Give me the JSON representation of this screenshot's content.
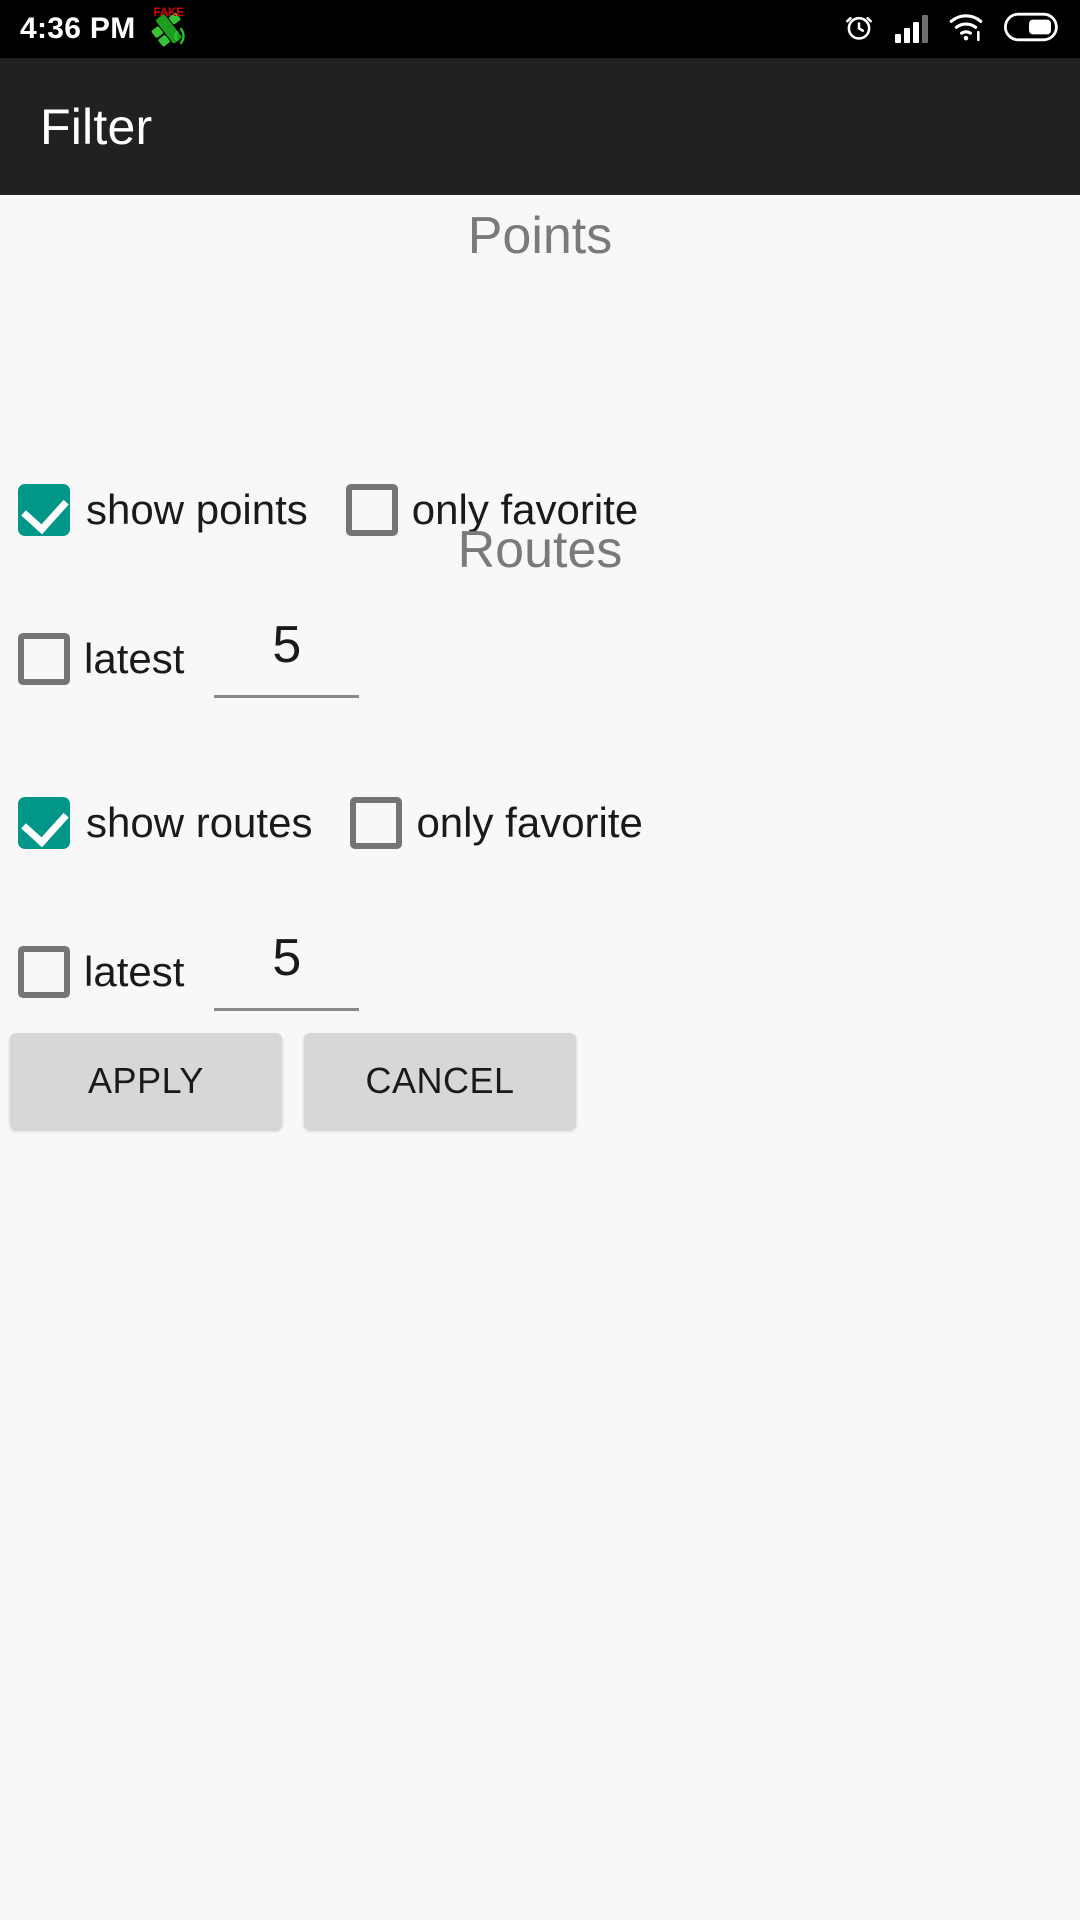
{
  "status_bar": {
    "time": "4:36 PM",
    "fake_gps_label": "FAKE",
    "icons": [
      "fake-gps-icon",
      "alarm-icon",
      "signal-icon",
      "wifi-icon",
      "battery-icon"
    ],
    "background_color": "#000000",
    "text_color": "#FFFFFF"
  },
  "app_bar": {
    "title": "Filter",
    "background_color": "#212121",
    "title_color": "#FFFFFF"
  },
  "theme": {
    "page_background": "#F8F8F8",
    "accent_checked": "#009688",
    "checkbox_border": "#757575",
    "section_header_color": "#7A7A7A",
    "button_background": "#D6D7D7",
    "body_text": "#1A1A1A"
  },
  "sections": [
    {
      "header": "Points",
      "show_checkbox": {
        "label": "show points",
        "checked": true
      },
      "favorite_checkbox": {
        "label": "only favorite",
        "checked": false
      },
      "latest_checkbox": {
        "label": "latest",
        "checked": false
      },
      "latest_value": "5"
    },
    {
      "header": "Routes",
      "show_checkbox": {
        "label": "show routes",
        "checked": true
      },
      "favorite_checkbox": {
        "label": "only favorite",
        "checked": false
      },
      "latest_checkbox": {
        "label": "latest",
        "checked": false
      },
      "latest_value": "5"
    }
  ],
  "buttons": {
    "apply_label": "APPLY",
    "cancel_label": "CANCEL"
  }
}
